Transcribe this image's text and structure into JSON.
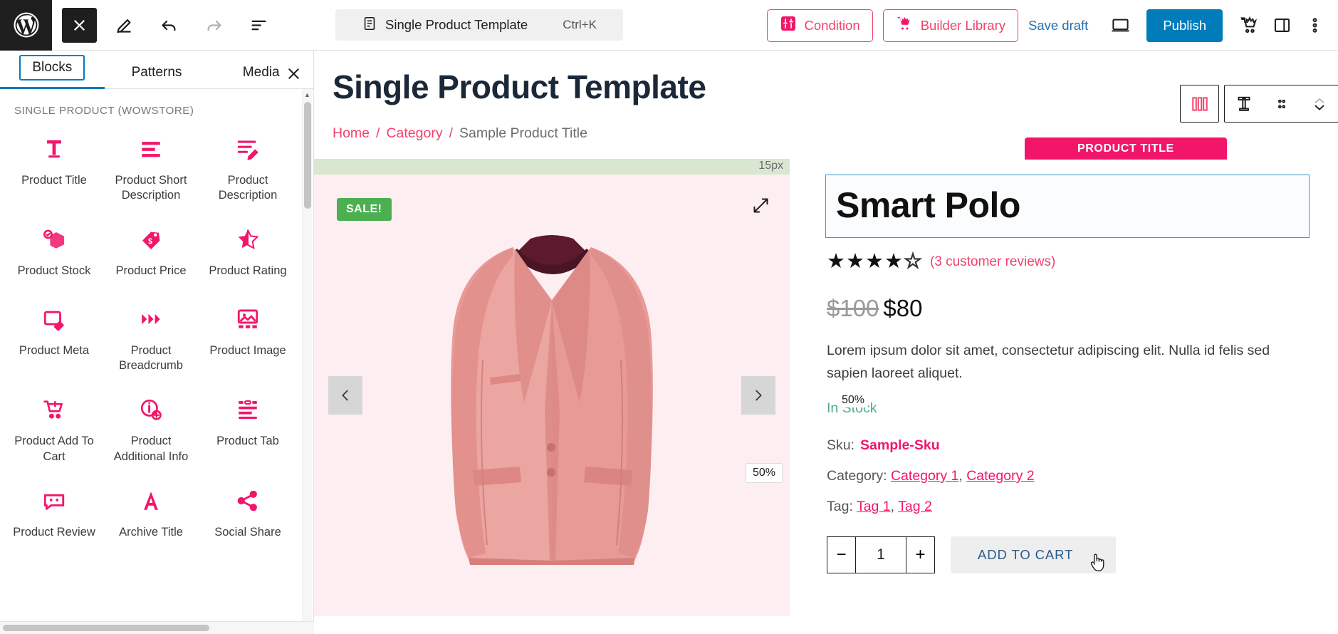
{
  "topbar": {
    "logo_icon": "wordpress-logo-icon",
    "close_icon": "close-icon",
    "edit_icon": "pencil-edit-icon",
    "undo_icon": "undo-icon",
    "redo_icon": "redo-icon",
    "list_view_icon": "list-view-icon",
    "document": {
      "icon": "document-icon",
      "title": "Single Product Template",
      "shortcut": "Ctrl+K"
    },
    "condition_button": {
      "label": "Condition",
      "icon": "condition-filter-icon"
    },
    "builder_library_button": {
      "label": "Builder Library",
      "icon": "wowstore-cart-icon"
    },
    "save_draft": "Save draft",
    "preview_icon": "desktop-preview-icon",
    "publish_button": "Publish",
    "wowstore_icon": "wowstore-cart-icon",
    "settings_sidebar_icon": "sidebar-panel-icon",
    "more_options_icon": "more-vertical-icon",
    "accent_pink": "#f2416b",
    "publish_blue": "#007cba"
  },
  "inserter": {
    "tabs": [
      {
        "label": "Blocks",
        "active": true
      },
      {
        "label": "Patterns",
        "active": false
      },
      {
        "label": "Media",
        "active": false
      }
    ],
    "close_icon": "close-icon",
    "category": "SINGLE PRODUCT (WOWSTORE)",
    "blocks": [
      {
        "label": "Product Title",
        "icon": "text-title-icon"
      },
      {
        "label": "Product Short Description",
        "icon": "short-description-lines-icon"
      },
      {
        "label": "Product Description",
        "icon": "description-pencil-icon"
      },
      {
        "label": "Product Stock",
        "icon": "box-check-icon"
      },
      {
        "label": "Product Price",
        "icon": "price-tag-icon"
      },
      {
        "label": "Product Rating",
        "icon": "half-star-icon"
      },
      {
        "label": "Product Meta",
        "icon": "meta-tag-icon"
      },
      {
        "label": "Product Breadcrumb",
        "icon": "triangles-breadcrumb-icon"
      },
      {
        "label": "Product Image",
        "icon": "image-gallery-icon"
      },
      {
        "label": "Product Add To Cart",
        "icon": "cart-plus-icon"
      },
      {
        "label": "Product Additional Info",
        "icon": "info-plus-icon"
      },
      {
        "label": "Product Tab",
        "icon": "tab-lines-icon"
      },
      {
        "label": "Product Review",
        "icon": "review-face-icon"
      },
      {
        "label": "Archive Title",
        "icon": "letter-a-icon"
      },
      {
        "label": "Social Share",
        "icon": "share-nodes-icon"
      }
    ]
  },
  "canvas": {
    "page_title": "Single Product Template",
    "breadcrumb": {
      "items": [
        {
          "label": "Home",
          "link": true
        },
        {
          "label": "Category",
          "link": true
        },
        {
          "label": "Sample Product Title",
          "link": false
        }
      ],
      "separator": "/"
    },
    "spacer_label": "15px",
    "gallery": {
      "sale_badge": "SALE!",
      "expand_icon": "expand-arrows-icon",
      "prev_icon": "chevron-left-icon",
      "next_icon": "chevron-right-icon",
      "zoom_tag": "50%",
      "image_alt": "pink blazer jacket"
    },
    "block_toolbar": {
      "badge": "PRODUCT TITLE",
      "buttons": [
        {
          "icon": "columns-block-icon",
          "name": "parent-columns-block"
        },
        {
          "icon": "text-title-icon",
          "name": "block-type-product-title"
        },
        {
          "icon": "drag-handle-icon",
          "name": "drag-handle"
        },
        {
          "icon": "move-updown-icon",
          "name": "move-up-down"
        },
        {
          "icon": "align-block-icon",
          "name": "block-alignment"
        },
        {
          "icon": "text-align-left-icon",
          "name": "text-align"
        },
        {
          "icon": "typography-icon",
          "name": "typography"
        },
        {
          "icon": "color-fill-icon",
          "name": "color-fill"
        },
        {
          "icon": "width-arrows-icon",
          "name": "width"
        },
        {
          "icon": "more-vertical-icon",
          "name": "more-options"
        }
      ]
    },
    "product": {
      "title": "Smart Polo",
      "rating": {
        "value": 4,
        "max": 5,
        "reviews_label": "(3 customer reviews)"
      },
      "price": {
        "old": "$100",
        "new": "$80"
      },
      "short_description": "Lorem ipsum dolor sit amet, consectetur adipiscing elit. Nulla id felis sed sapien laoreet aliquet.",
      "stock": "In Stock",
      "stock_zoom": "50%",
      "sku": {
        "label": "Sku:",
        "value": "Sample-Sku"
      },
      "category": {
        "label": "Category:",
        "values": [
          "Category 1",
          "Category 2"
        ]
      },
      "tag": {
        "label": "Tag:",
        "values": [
          "Tag 1",
          "Tag 2"
        ]
      },
      "cart": {
        "minus": "−",
        "quantity": "1",
        "plus": "+",
        "add_to_cart": "ADD TO CART"
      }
    }
  }
}
